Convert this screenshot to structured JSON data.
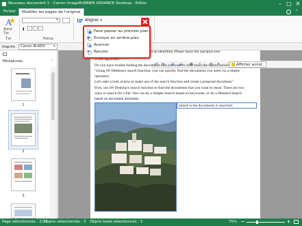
{
  "window": {
    "title": "Nouveau document 1 - Canon imageRUNNER ADVANCE Desktop - Editor"
  },
  "ribbon": {
    "tabs": [
      {
        "label": "Fichier",
        "active": false
      },
      {
        "label": "Modifier les pages de l'original",
        "active": true
      }
    ],
    "add_text_label": "Ajout Txt",
    "group_txt": "Txt",
    "group_police": "Police",
    "align_button": "Aligner",
    "printer_label": "Imprim",
    "printer_value": "Canon iR-ADV"
  },
  "dropdown": {
    "items": [
      {
        "label": "Faire passer au premier plan",
        "icon": "bring-to-front-icon"
      },
      {
        "label": "Envoyer en arrière-plan",
        "icon": "send-to-back-icon"
      },
      {
        "label": "Avancer",
        "icon": "bring-forward-icon"
      },
      {
        "label": "Reculer",
        "icon": "send-backward-icon"
      }
    ]
  },
  "edit_toolbar": {
    "show_annotations": "Afficher annot."
  },
  "sidebar": {
    "title": "Miniatures",
    "pages": [
      "1",
      "2",
      "3"
    ]
  },
  "document": {
    "lines": [
      "ver, the language used can be identified. Please insert the narration text",
      "Do you have trouble finding the documents that you want to refer to on the shared server?",
      "\"Using iW Desktop's search function, you can quickly find the documents you need via a simple",
      "operation.",
      "Let's take a look at how to make use of the search function and create a proposal document.\"",
      "First, use iW Desktop's search function to find the documents that you want to reuse. There are two",
      "ways to search for a file. You can do a Simple Search based on keywords, or do a Detailed Search",
      "based on document attributes."
    ],
    "selected_text": "tained in the documents is searched."
  },
  "status": {
    "page_selected": "Page sélectionnée : 2/11",
    "objects_selected": "Objets sélectionnés : 3",
    "text_objects_selected": "Objets texte sélectionnés : 3",
    "zoom": "75%"
  },
  "colors": {
    "accent": "#1f7f4c",
    "highlight": "#e02020"
  }
}
